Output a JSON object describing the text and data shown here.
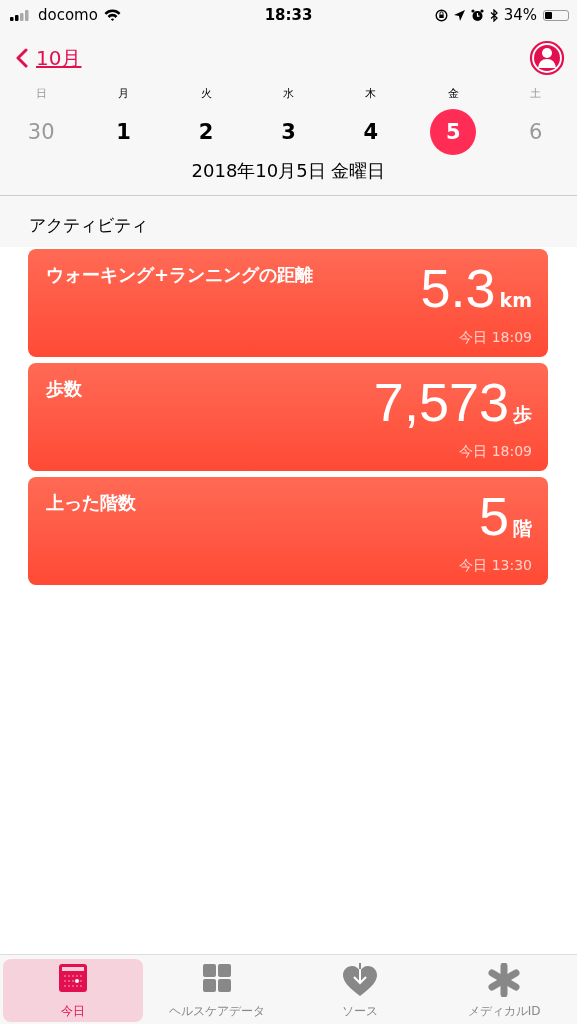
{
  "status_bar": {
    "carrier": "docomo",
    "time": "18:33",
    "battery": "34%"
  },
  "nav": {
    "back_label": "10月"
  },
  "week": [
    {
      "weekday": "日",
      "day": "30",
      "dimmed": true,
      "selected": false
    },
    {
      "weekday": "月",
      "day": "1",
      "dimmed": false,
      "selected": false
    },
    {
      "weekday": "火",
      "day": "2",
      "dimmed": false,
      "selected": false
    },
    {
      "weekday": "水",
      "day": "3",
      "dimmed": false,
      "selected": false
    },
    {
      "weekday": "木",
      "day": "4",
      "dimmed": false,
      "selected": false
    },
    {
      "weekday": "金",
      "day": "5",
      "dimmed": false,
      "selected": true
    },
    {
      "weekday": "土",
      "day": "6",
      "dimmed": true,
      "selected": false
    }
  ],
  "date_label": "2018年10月5日 金曜日",
  "section_title": "アクティビティ",
  "cards": [
    {
      "title": "ウォーキング+ランニングの距離",
      "value": "5.3",
      "unit": "km",
      "time": "今日 18:09"
    },
    {
      "title": "歩数",
      "value": "7,573",
      "unit": "歩",
      "time": "今日 18:09"
    },
    {
      "title": "上った階数",
      "value": "5",
      "unit": "階",
      "time": "今日 13:30"
    }
  ],
  "tabs": [
    {
      "label": "今日",
      "kind": "calendar",
      "selected": true
    },
    {
      "label": "ヘルスケアデータ",
      "kind": "grid",
      "selected": false
    },
    {
      "label": "ソース",
      "kind": "heart",
      "selected": false
    },
    {
      "label": "メディカルID",
      "kind": "asterisk",
      "selected": false
    }
  ]
}
